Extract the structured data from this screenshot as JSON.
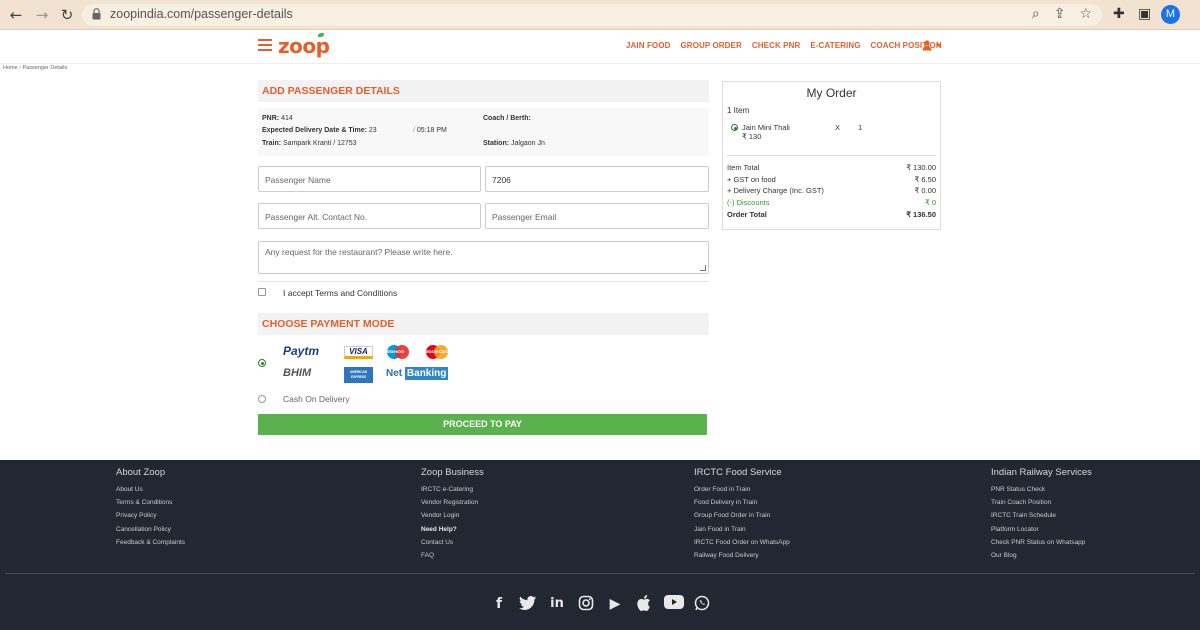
{
  "browser": {
    "url": "zoopindia.com/passenger-details",
    "avatar_letter": "M"
  },
  "header": {
    "logo_text": "zoop",
    "nav": [
      "JAIN FOOD",
      "GROUP ORDER",
      "CHECK PNR",
      "E-CATERING",
      "COACH POSITION"
    ]
  },
  "breadcrumb": {
    "home": "Home",
    "current": "Passenger Details"
  },
  "passenger": {
    "section_title": "ADD PASSENGER DETAILS",
    "pnr_label": "PNR:",
    "pnr_value": "414",
    "delivery_label": "Expected Delivery Date & Time:",
    "delivery_date": "23",
    "delivery_time": "05:18 PM",
    "train_label": "Train:",
    "train_value": "Sampark Kranti / 12753",
    "coach_label": "Coach / Berth:",
    "station_label": "Station:",
    "station_value": "Jalgaon Jn",
    "name_placeholder": "Passenger Name",
    "contact_value": "7206",
    "alt_contact_placeholder": "Passenger Alt. Contact No.",
    "email_placeholder": "Passenger Email",
    "request_placeholder": "Any request for the restaurant? Please write here.",
    "accept_text": "I accept",
    "terms_link": "Terms and Conditions"
  },
  "payment": {
    "section_title": "CHOOSE PAYMENT MODE",
    "online_methods": [
      "Paytm",
      "VISA",
      "Maestro",
      "MasterCard",
      "BHIM",
      "AMERICAN EXPRESS",
      "Net",
      "Banking"
    ],
    "cod_label": "Cash On Delivery",
    "proceed_label": "PROCEED TO PAY"
  },
  "order": {
    "title": "My Order",
    "item_count": "1 Item",
    "item_name": "Jain Mini Thali",
    "item_price": "₹ 130",
    "item_x": "X",
    "item_qty": "1",
    "rows": [
      {
        "label": "Item Total",
        "value": "₹ 130.00"
      },
      {
        "label": "+ GST on food",
        "value": "₹ 6.50"
      },
      {
        "label": "+ Delivery Charge (Inc. GST)",
        "value": "₹ 0.00"
      },
      {
        "label": "(-) Discounts",
        "value": "₹ 0"
      },
      {
        "label": "Order Total",
        "value": "₹ 136.50"
      }
    ],
    "discount_color": "#2e9a2e"
  },
  "footer": {
    "about": {
      "title": "About Zoop",
      "links": [
        "About Us",
        "Terms & Conditions",
        "Privacy Policy",
        "Cancellation Policy",
        "Feedback & Complaints"
      ]
    },
    "business": {
      "title": "Zoop Business",
      "links": [
        "IRCTC e-Catering",
        "Vendor Registration",
        "Vendor Login",
        "Need Help?",
        "Contact Us",
        "FAQ"
      ]
    },
    "irctc": {
      "title": "IRCTC Food Service",
      "links": [
        "Order Food in Train",
        "Food Delivery in Train",
        "Group Food Order in Train",
        "Jain Food in Train",
        "IRCTC Food Order on WhatsApp",
        "Railway Food Delivery"
      ]
    },
    "railway": {
      "title": "Indian Railway Services",
      "links": [
        "PNR Status Check",
        "Train Coach Position",
        "IRCTC Train Schedule",
        "Platform Locator",
        "Check PNR Status on Whatsapp",
        "Our Blog"
      ]
    },
    "social_icons": [
      "facebook-icon",
      "twitter-icon",
      "linkedin-icon",
      "instagram-icon",
      "play-store-icon",
      "apple-icon",
      "youtube-icon",
      "whatsapp-icon"
    ]
  },
  "colors": {
    "brand": "#e65f2b",
    "proceed": "#5cb14f",
    "footer_bg": "#222831"
  }
}
